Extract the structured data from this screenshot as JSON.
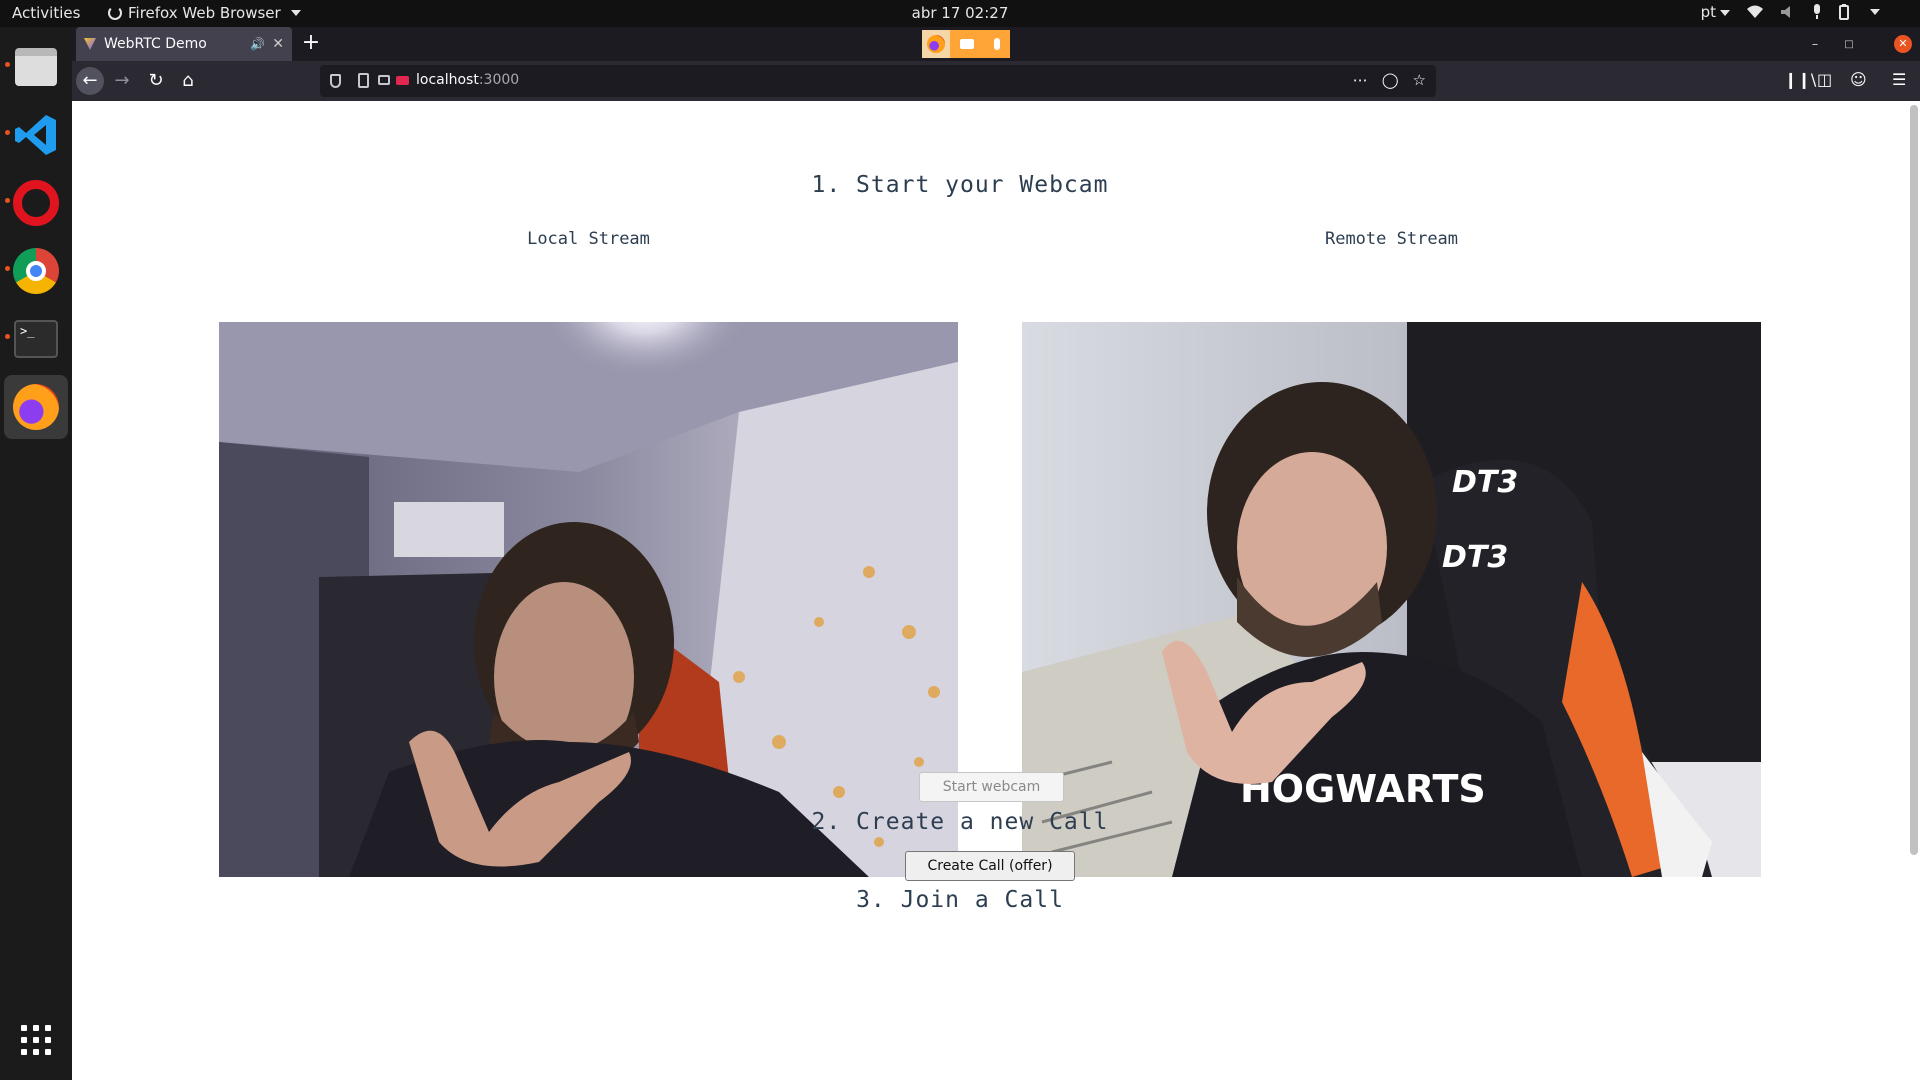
{
  "system_bar": {
    "activities": "Activities",
    "app_name": "Firefox Web Browser",
    "clock": "abr 17  02:27",
    "language": "pt"
  },
  "dock": {
    "items": [
      "files",
      "vscode",
      "opera",
      "chrome",
      "terminal",
      "firefox"
    ],
    "app_grid": "show-applications"
  },
  "browser": {
    "tab_title": "WebRTC Demo",
    "new_tab": "+",
    "url_host": "localhost",
    "url_port": ":3000",
    "sharing_indicator": [
      "camera",
      "microphone"
    ]
  },
  "page": {
    "section1_title": "1. Start your Webcam",
    "local_label": "Local Stream",
    "remote_label": "Remote Stream",
    "start_webcam": "Start webcam",
    "section2_title": "2. Create a new Call",
    "create_call": "Create Call (offer)",
    "section3_title": "3. Join a Call"
  },
  "colors": {
    "accent": "#e95420",
    "text": "#2c3e50",
    "tab_bg": "#42414d",
    "toolbar_bg": "#2b2a33"
  }
}
